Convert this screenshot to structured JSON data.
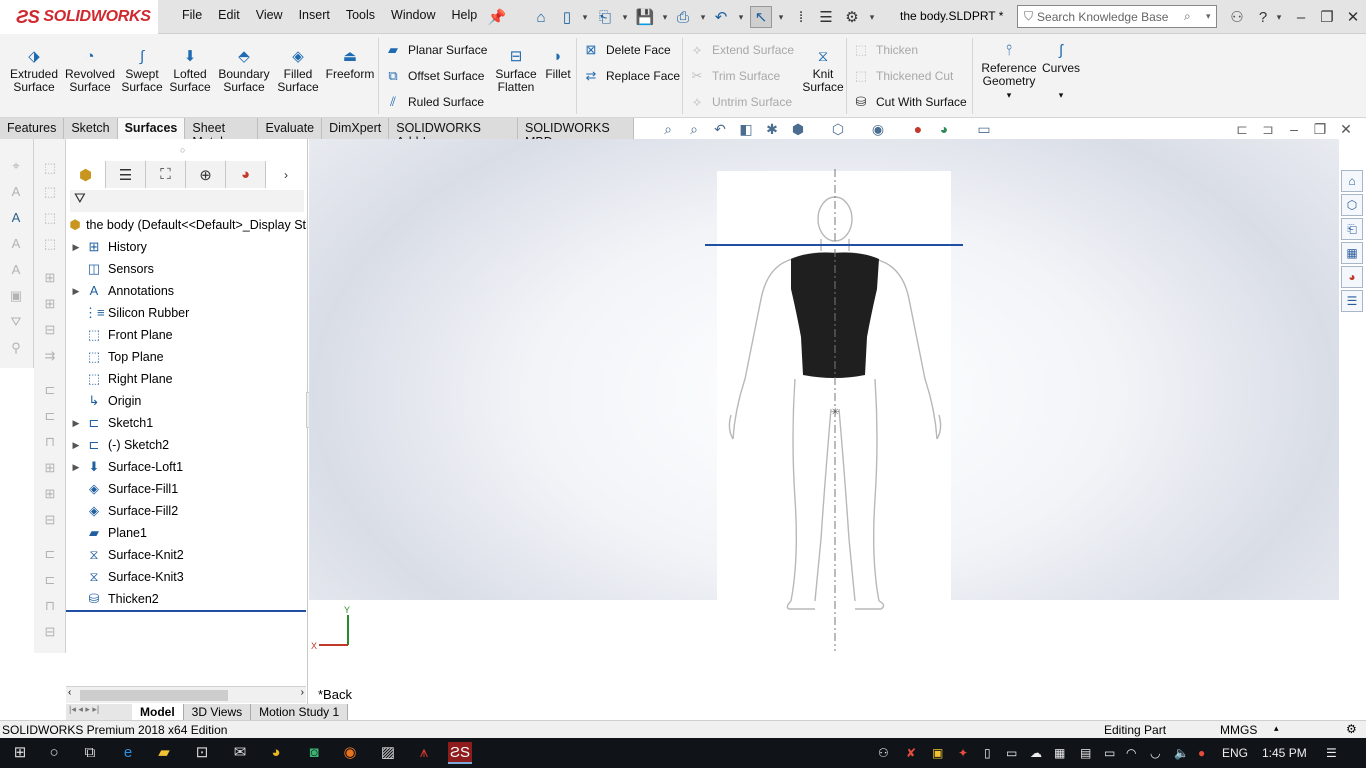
{
  "app": {
    "brand": "SOLIDWORKS",
    "document_title": "the body.SLDPRT *",
    "search_placeholder": "Search Knowledge Base"
  },
  "menu": [
    "File",
    "Edit",
    "View",
    "Insert",
    "Tools",
    "Window",
    "Help"
  ],
  "command_manager": {
    "big_buttons": [
      {
        "label1": "Extruded",
        "label2": "Surface",
        "icon": "extruded-surface-icon"
      },
      {
        "label1": "Revolved",
        "label2": "Surface",
        "icon": "revolved-surface-icon"
      },
      {
        "label1": "Swept",
        "label2": "Surface",
        "icon": "swept-surface-icon"
      },
      {
        "label1": "Lofted",
        "label2": "Surface",
        "icon": "lofted-surface-icon"
      },
      {
        "label1": "Boundary",
        "label2": "Surface",
        "icon": "boundary-surface-icon"
      },
      {
        "label1": "Filled",
        "label2": "Surface",
        "icon": "filled-surface-icon"
      },
      {
        "label1": "Freeform",
        "label2": "",
        "icon": "freeform-icon"
      }
    ],
    "group1": [
      {
        "label": "Planar Surface",
        "enabled": true
      },
      {
        "label": "Offset Surface",
        "enabled": true
      },
      {
        "label": "Ruled Surface",
        "enabled": true
      }
    ],
    "surface_flatten": {
      "label1": "Surface",
      "label2": "Flatten"
    },
    "fillet": "Fillet",
    "group2": [
      {
        "label": "Delete Face",
        "enabled": true
      },
      {
        "label": "Replace Face",
        "enabled": true
      }
    ],
    "group3": [
      {
        "label": "Extend Surface",
        "enabled": false
      },
      {
        "label": "Trim Surface",
        "enabled": false
      },
      {
        "label": "Untrim Surface",
        "enabled": false
      }
    ],
    "knit_surface": {
      "label1": "Knit",
      "label2": "Surface"
    },
    "group4": [
      {
        "label": "Thicken",
        "enabled": false
      },
      {
        "label": "Thickened Cut",
        "enabled": false
      },
      {
        "label": "Cut With Surface",
        "enabled": true
      }
    ],
    "reference_geometry": {
      "label1": "Reference",
      "label2": "Geometry"
    },
    "curves": "Curves"
  },
  "tabs": [
    {
      "label": "Features",
      "active": false
    },
    {
      "label": "Sketch",
      "active": false
    },
    {
      "label": "Surfaces",
      "active": true
    },
    {
      "label": "Sheet Metal",
      "active": false
    },
    {
      "label": "Evaluate",
      "active": false
    },
    {
      "label": "DimXpert",
      "active": false
    },
    {
      "label": "SOLIDWORKS Add-Ins",
      "active": false
    },
    {
      "label": "SOLIDWORKS MBD",
      "active": false
    }
  ],
  "feature_tree": {
    "root": "the body  (Default<<Default>_Display St",
    "items": [
      {
        "label": "History",
        "expandable": true,
        "icon": "history-icon"
      },
      {
        "label": "Sensors",
        "expandable": false,
        "icon": "sensors-icon"
      },
      {
        "label": "Annotations",
        "expandable": true,
        "icon": "annotations-icon"
      },
      {
        "label": "Silicon Rubber",
        "expandable": false,
        "icon": "material-icon"
      },
      {
        "label": "Front Plane",
        "expandable": false,
        "icon": "plane-icon"
      },
      {
        "label": "Top Plane",
        "expandable": false,
        "icon": "plane-icon"
      },
      {
        "label": "Right Plane",
        "expandable": false,
        "icon": "plane-icon"
      },
      {
        "label": "Origin",
        "expandable": false,
        "icon": "origin-icon"
      },
      {
        "label": "Sketch1",
        "expandable": true,
        "icon": "sketch-icon"
      },
      {
        "label": "(-) Sketch2",
        "expandable": true,
        "icon": "sketch-icon"
      },
      {
        "label": "Surface-Loft1",
        "expandable": true,
        "icon": "surface-loft-icon"
      },
      {
        "label": "Surface-Fill1",
        "expandable": false,
        "icon": "surface-fill-icon"
      },
      {
        "label": "Surface-Fill2",
        "expandable": false,
        "icon": "surface-fill-icon"
      },
      {
        "label": "Plane1",
        "expandable": false,
        "icon": "plane-solid-icon"
      },
      {
        "label": "Surface-Knit2",
        "expandable": false,
        "icon": "surface-knit-icon"
      },
      {
        "label": "Surface-Knit3",
        "expandable": false,
        "icon": "surface-knit-icon"
      },
      {
        "label": "Thicken2",
        "expandable": false,
        "icon": "thicken-icon"
      }
    ]
  },
  "bottom_tabs": [
    {
      "label": "Model",
      "active": true
    },
    {
      "label": "3D Views",
      "active": false
    },
    {
      "label": "Motion Study 1",
      "active": false
    }
  ],
  "graphics": {
    "view_name": "*Back",
    "triad_y": "Y",
    "triad_x": "X"
  },
  "status_bar": {
    "edition": "SOLIDWORKS Premium 2018 x64 Edition",
    "mode": "Editing Part",
    "units": "MMGS"
  },
  "taskbar": {
    "language": "ENG",
    "time": "1:45 PM"
  },
  "colors": {
    "brand_red": "#d1272e",
    "accent_blue": "#1f6ab1",
    "plane_line": "#1e4fa3",
    "taskbar": "#101419"
  }
}
